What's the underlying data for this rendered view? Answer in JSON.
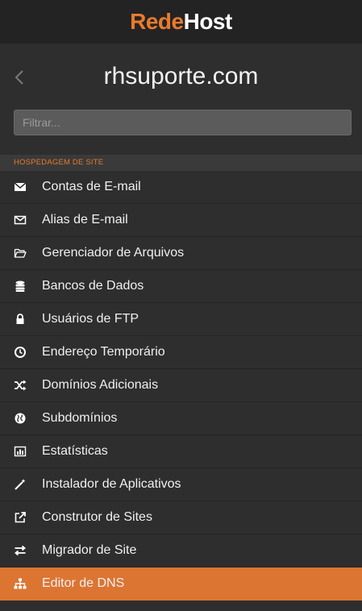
{
  "brand": {
    "logo_accent": "Rede",
    "logo_rest": "Host",
    "accent_color": "#e87a2e"
  },
  "header": {
    "title": "rhsuporte.com",
    "back_icon": "chevron-left-icon"
  },
  "search": {
    "placeholder": "Filtrar..."
  },
  "section": {
    "title": "HOSPEDAGEM DE SITE"
  },
  "menu": {
    "items": [
      {
        "label": "Contas de E-mail",
        "icon": "envelope-icon"
      },
      {
        "label": "Alias de E-mail",
        "icon": "envelope-outline-icon"
      },
      {
        "label": "Gerenciador de Arquivos",
        "icon": "folder-open-icon"
      },
      {
        "label": "Bancos de Dados",
        "icon": "database-icon"
      },
      {
        "label": "Usuários de FTP",
        "icon": "lock-icon"
      },
      {
        "label": "Endereço Temporário",
        "icon": "clock-icon"
      },
      {
        "label": "Domínios Adicionais",
        "icon": "random-icon"
      },
      {
        "label": "Subdomínios",
        "icon": "globe-icon"
      },
      {
        "label": "Estatísticas",
        "icon": "bar-chart-icon"
      },
      {
        "label": "Instalador de Aplicativos",
        "icon": "magic-wand-icon"
      },
      {
        "label": "Construtor de Sites",
        "icon": "external-link-icon"
      },
      {
        "label": "Migrador de Site",
        "icon": "exchange-icon"
      },
      {
        "label": "Editor de DNS",
        "icon": "sitemap-icon",
        "active": true
      }
    ]
  }
}
